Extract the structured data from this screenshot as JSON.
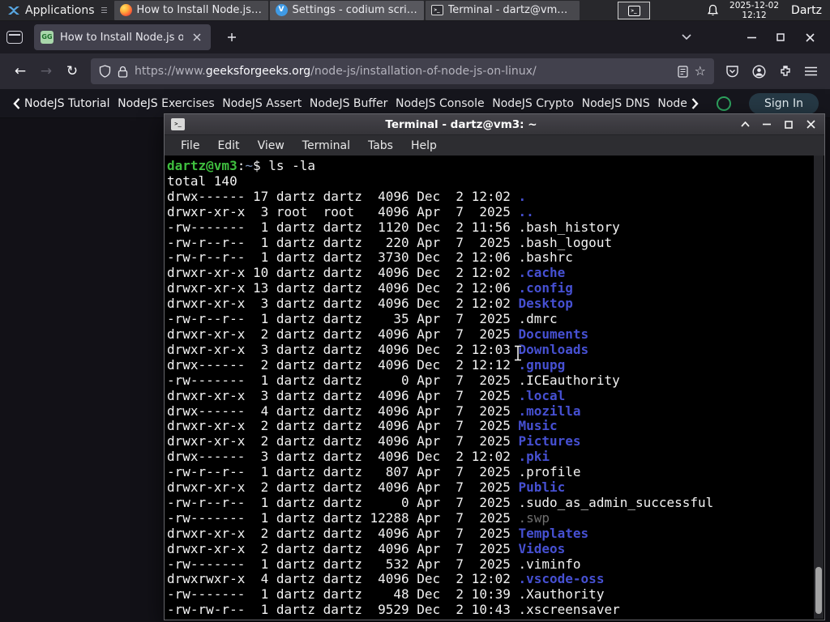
{
  "panel": {
    "applications_label": "Applications",
    "tasks": [
      {
        "icon": "firefox",
        "title": "How to Install Node.js o..."
      },
      {
        "icon": "vscodium",
        "title": "Settings - codium script..."
      },
      {
        "icon": "terminal",
        "title": "Terminal - dartz@vm3: ~"
      }
    ],
    "clock_date": "2025-12-02",
    "clock_time": "12:12",
    "user_label": "Dartz"
  },
  "browser": {
    "tab_title": "How to Install Node.js on",
    "favicon_text": "GG",
    "url": {
      "prefix": "https://www.",
      "domain": "geeksforgeeks.org",
      "path": "/node-js/installation-of-node-js-on-linux/"
    }
  },
  "site_nav": {
    "items": [
      "NodeJS Tutorial",
      "NodeJS Exercises",
      "NodeJS Assert",
      "NodeJS Buffer",
      "NodeJS Console",
      "NodeJS Crypto",
      "NodeJS DNS",
      "Node"
    ],
    "sign_in_label": "Sign In"
  },
  "terminal": {
    "window_title": "Terminal - dartz@vm3: ~",
    "menu_items": [
      "File",
      "Edit",
      "View",
      "Terminal",
      "Tabs",
      "Help"
    ],
    "prompt": {
      "user_host": "dartz@vm3",
      "separator": ":",
      "path": "~",
      "symbol": "$",
      "command": "ls -la"
    },
    "total_line": "total 140",
    "listing": [
      {
        "pre": "drwx------ 17 dartz dartz  4096 Dec  2 12:02 ",
        "name": ".",
        "type": "dir"
      },
      {
        "pre": "drwxr-xr-x  3 root  root   4096 Apr  7  2025 ",
        "name": "..",
        "type": "dir"
      },
      {
        "pre": "-rw-------  1 dartz dartz  1120 Dec  2 11:56 ",
        "name": ".bash_history",
        "type": "file"
      },
      {
        "pre": "-rw-r--r--  1 dartz dartz   220 Apr  7  2025 ",
        "name": ".bash_logout",
        "type": "file"
      },
      {
        "pre": "-rw-r--r--  1 dartz dartz  3730 Dec  2 12:06 ",
        "name": ".bashrc",
        "type": "file"
      },
      {
        "pre": "drwxr-xr-x 10 dartz dartz  4096 Dec  2 12:02 ",
        "name": ".cache",
        "type": "dir"
      },
      {
        "pre": "drwxr-xr-x 13 dartz dartz  4096 Dec  2 12:06 ",
        "name": ".config",
        "type": "dir"
      },
      {
        "pre": "drwxr-xr-x  3 dartz dartz  4096 Dec  2 12:02 ",
        "name": "Desktop",
        "type": "dir"
      },
      {
        "pre": "-rw-r--r--  1 dartz dartz    35 Apr  7  2025 ",
        "name": ".dmrc",
        "type": "file"
      },
      {
        "pre": "drwxr-xr-x  2 dartz dartz  4096 Apr  7  2025 ",
        "name": "Documents",
        "type": "dir"
      },
      {
        "pre": "drwxr-xr-x  3 dartz dartz  4096 Dec  2 12:03 ",
        "name": "Downloads",
        "type": "dir"
      },
      {
        "pre": "drwx------  2 dartz dartz  4096 Dec  2 12:12 ",
        "name": ".gnupg",
        "type": "dir"
      },
      {
        "pre": "-rw-------  1 dartz dartz     0 Apr  7  2025 ",
        "name": ".ICEauthority",
        "type": "file"
      },
      {
        "pre": "drwxr-xr-x  3 dartz dartz  4096 Apr  7  2025 ",
        "name": ".local",
        "type": "dir"
      },
      {
        "pre": "drwx------  4 dartz dartz  4096 Apr  7  2025 ",
        "name": ".mozilla",
        "type": "dir"
      },
      {
        "pre": "drwxr-xr-x  2 dartz dartz  4096 Apr  7  2025 ",
        "name": "Music",
        "type": "dir"
      },
      {
        "pre": "drwxr-xr-x  2 dartz dartz  4096 Apr  7  2025 ",
        "name": "Pictures",
        "type": "dir"
      },
      {
        "pre": "drwx------  3 dartz dartz  4096 Dec  2 12:02 ",
        "name": ".pki",
        "type": "dir"
      },
      {
        "pre": "-rw-r--r--  1 dartz dartz   807 Apr  7  2025 ",
        "name": ".profile",
        "type": "file"
      },
      {
        "pre": "drwxr-xr-x  2 dartz dartz  4096 Apr  7  2025 ",
        "name": "Public",
        "type": "dir"
      },
      {
        "pre": "-rw-r--r--  1 dartz dartz     0 Apr  7  2025 ",
        "name": ".sudo_as_admin_successful",
        "type": "file"
      },
      {
        "pre": "-rw-------  1 dartz dartz 12288 Apr  7  2025 ",
        "name": ".swp",
        "type": "dim"
      },
      {
        "pre": "drwxr-xr-x  2 dartz dartz  4096 Apr  7  2025 ",
        "name": "Templates",
        "type": "dir"
      },
      {
        "pre": "drwxr-xr-x  2 dartz dartz  4096 Apr  7  2025 ",
        "name": "Videos",
        "type": "dir"
      },
      {
        "pre": "-rw-------  1 dartz dartz   532 Apr  7  2025 ",
        "name": ".viminfo",
        "type": "file"
      },
      {
        "pre": "drwxrwxr-x  4 dartz dartz  4096 Dec  2 12:02 ",
        "name": ".vscode-oss",
        "type": "dir"
      },
      {
        "pre": "-rw-------  1 dartz dartz    48 Dec  2 10:39 ",
        "name": ".Xauthority",
        "type": "file"
      },
      {
        "pre": "-rw-rw-r--  1 dartz dartz  9529 Dec  2 10:43 ",
        "name": ".xscreensaver",
        "type": "file"
      }
    ],
    "colors": {
      "background": "#000000",
      "foreground": "#f2f2f2",
      "prompt_green": "#3fbf3f",
      "path_blue": "#7d93b8",
      "dir_blue": "#4650d2",
      "dim_gray": "#6f6f6f"
    }
  }
}
